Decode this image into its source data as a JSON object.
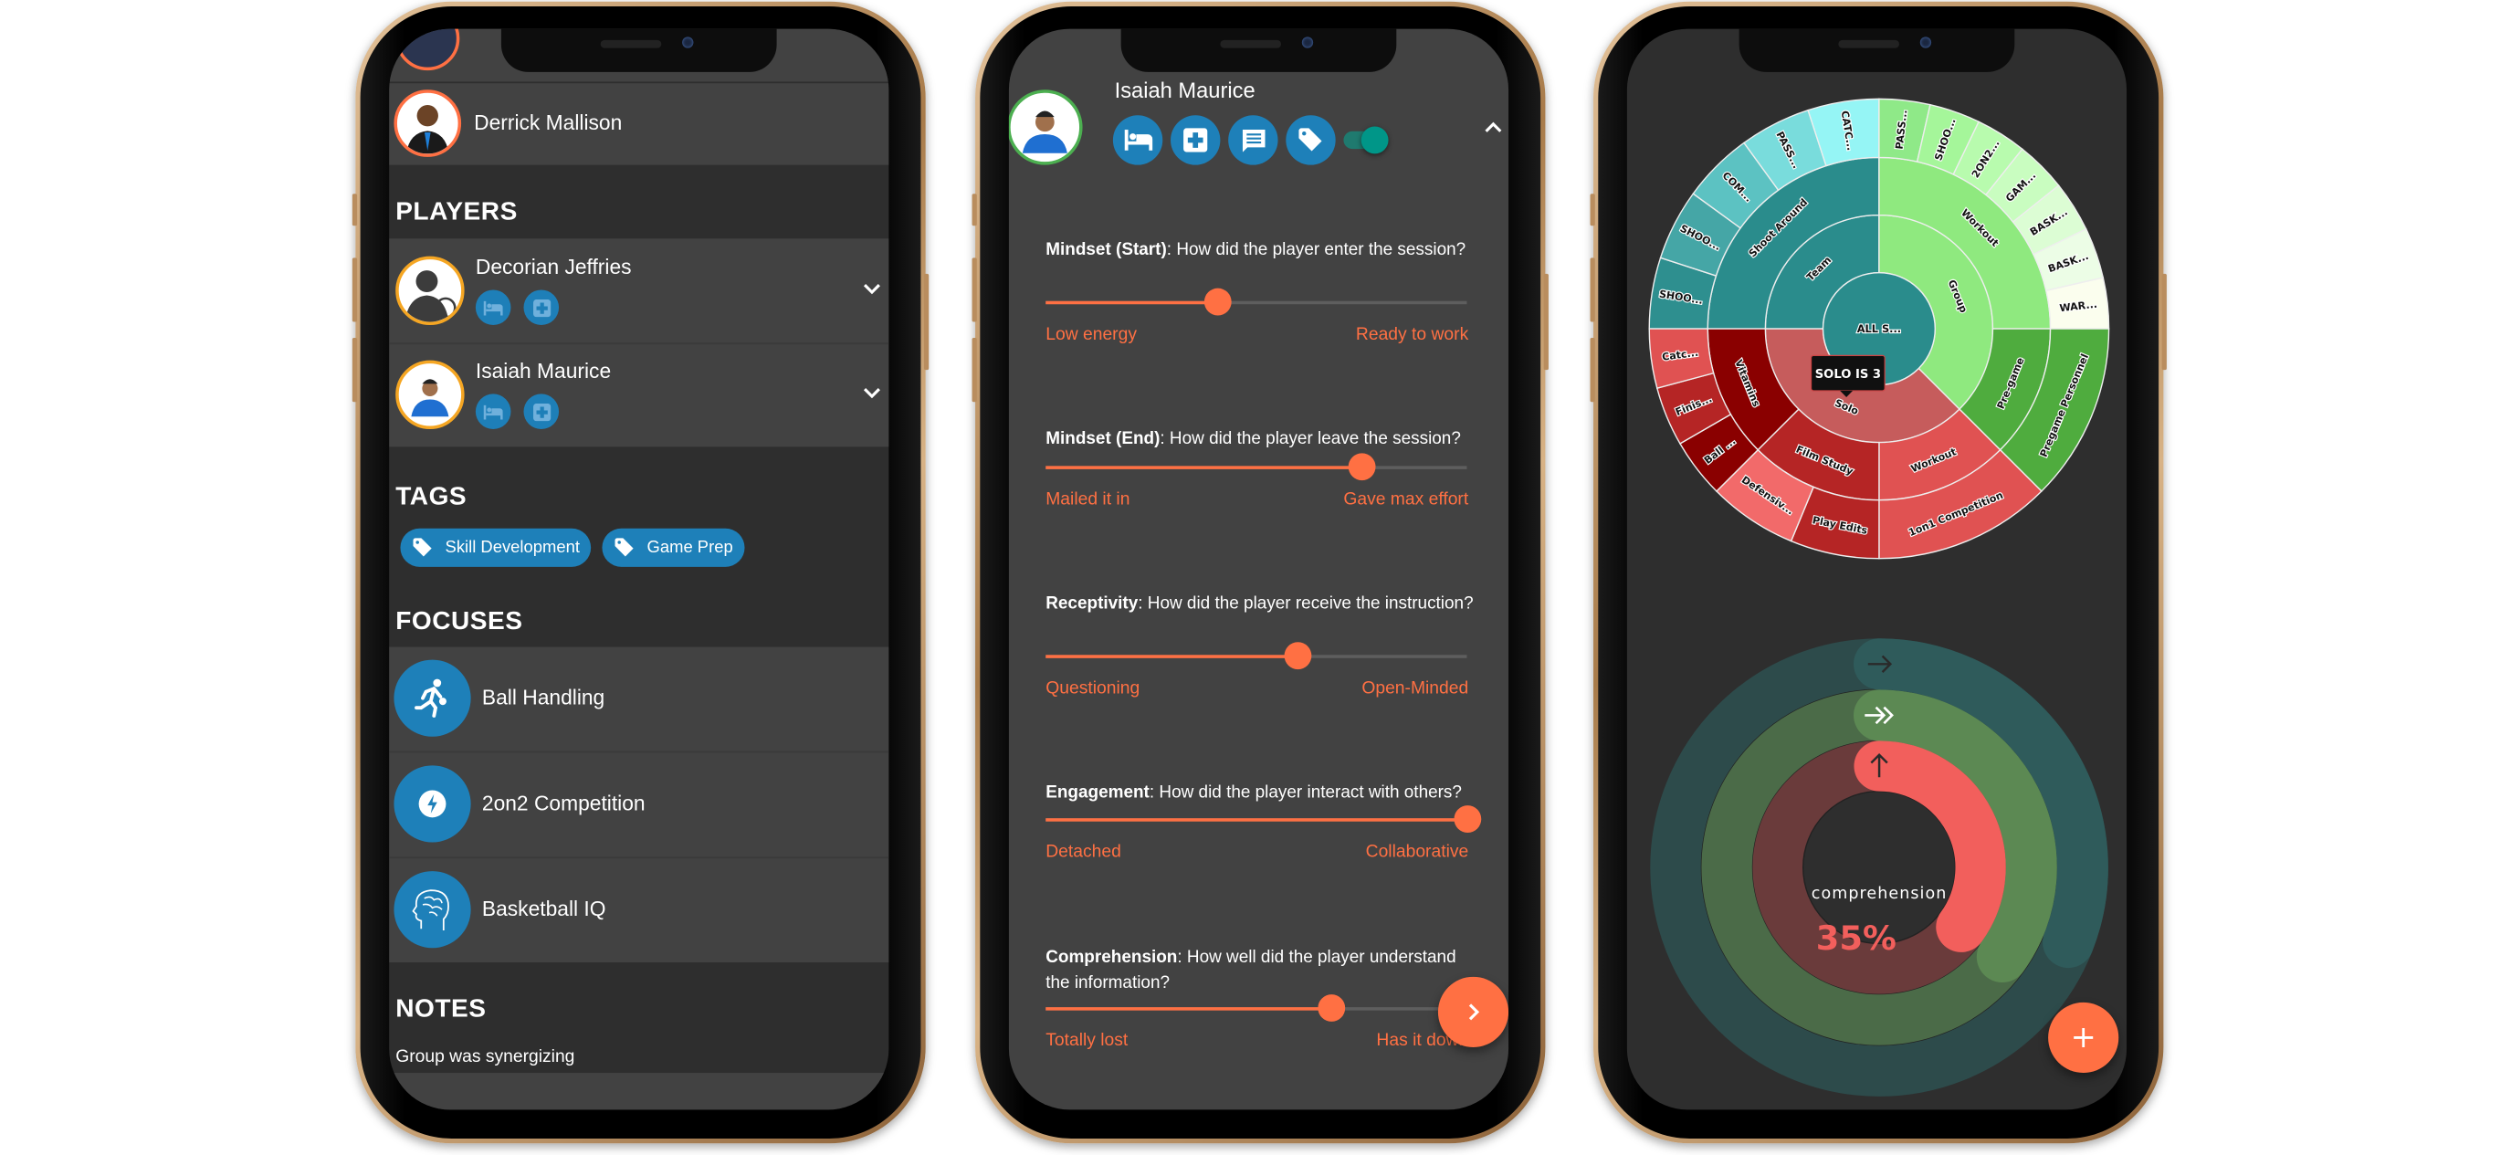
{
  "phone1": {
    "staff": [
      {
        "name": "Derrick Mallison"
      }
    ],
    "players_header": "PLAYERS",
    "players": [
      {
        "name": "Decorian Jeffries",
        "icons": [
          "bed-icon",
          "medical-icon"
        ]
      },
      {
        "name": "Isaiah Maurice",
        "icons": [
          "bed-icon",
          "medical-icon"
        ]
      }
    ],
    "tags_header": "TAGS",
    "tags": [
      {
        "label": "Skill Development"
      },
      {
        "label": "Game Prep"
      }
    ],
    "focuses_header": "FOCUSES",
    "focuses": [
      {
        "label": "Ball Handling",
        "icon": "dribbling-player-icon"
      },
      {
        "label": "2on2 Competition",
        "icon": "lightning-icon"
      },
      {
        "label": "Basketball IQ",
        "icon": "brain-icon"
      }
    ],
    "notes_header": "NOTES",
    "note": "Group was synergizing"
  },
  "phone2": {
    "player_name": "Isaiah Maurice",
    "toggle_on": true,
    "action_icons": [
      "bed-icon",
      "medical-icon",
      "message-icon",
      "tag-icon"
    ],
    "sliders": [
      {
        "title": "Mindset (Start)",
        "question": ": How did the player enter the session?",
        "min_label": "Low energy",
        "max_label": "Ready to work",
        "value": 0.41
      },
      {
        "title": "Mindset (End)",
        "question": ": How did the player leave the session?",
        "min_label": "Mailed it in",
        "max_label": "Gave max effort",
        "value": 0.75
      },
      {
        "title": "Receptivity",
        "question": ": How did the player receive the instruction?",
        "min_label": "Questioning",
        "max_label": "Open-Minded",
        "value": 0.6
      },
      {
        "title": "Engagement",
        "question": ": How did the player interact with others?",
        "min_label": "Detached",
        "max_label": "Collaborative",
        "value": 1.0
      },
      {
        "title": "Comprehension",
        "question": ": How well did the player understand the information?",
        "min_label": "Totally lost",
        "max_label": "Has it down",
        "value": 0.68
      }
    ],
    "fab_icon": "chevron-right-icon"
  },
  "phone3": {
    "fab_icon": "plus-icon"
  },
  "colors": {
    "accent": "#ff7043",
    "blue": "#1e80b9",
    "toggle": "#009688"
  },
  "chart_data": [
    {
      "type": "sunburst",
      "root": {
        "label": "ALL S...",
        "color": "#2a8c8c"
      },
      "tooltip": "SOLO IS 3",
      "children": [
        {
          "label": "Team",
          "value": 2,
          "color": "#2a8c8c",
          "children": [
            {
              "label": "Shoot Around",
              "value": 2,
              "color": "#2a8c8c",
              "children": [
                {
                  "label": "SHOO...",
                  "color": "#2e8f8f"
                },
                {
                  "label": "SHOO...",
                  "color": "#45a6a6"
                },
                {
                  "label": "COM...",
                  "color": "#5cc2c2"
                },
                {
                  "label": "PASS...",
                  "color": "#79dcdc"
                },
                {
                  "label": "CATC...",
                  "color": "#95f5f5"
                }
              ]
            }
          ]
        },
        {
          "label": "Group",
          "value": 3,
          "color": "#8fe97f",
          "children": [
            {
              "label": "Workout",
              "value": 2,
              "color": "#8fe97f",
              "children": [
                {
                  "label": "PASS...",
                  "color": "#8fe988"
                },
                {
                  "label": "SHOO...",
                  "color": "#a5f69a"
                },
                {
                  "label": "2ON2...",
                  "color": "#b8fbae"
                },
                {
                  "label": "GAM...",
                  "color": "#c9fdc0"
                },
                {
                  "label": "BASK...",
                  "color": "#dcfdd4"
                },
                {
                  "label": "BASK...",
                  "color": "#ecfde6"
                },
                {
                  "label": "WAR...",
                  "color": "#fbfeee"
                }
              ]
            },
            {
              "label": "Pre-game",
              "value": 1,
              "color": "#4fac3e",
              "children": [
                {
                  "label": "Pregame Personnel",
                  "color": "#4fac3e"
                }
              ]
            }
          ]
        },
        {
          "label": "Solo",
          "value": 3,
          "color": "#c65c5c",
          "children": [
            {
              "label": "Workout",
              "value": 1,
              "color": "#e05252",
              "children": [
                {
                  "label": "1on1 Competition",
                  "color": "#e05252"
                }
              ]
            },
            {
              "label": "Film Study",
              "value": 1,
              "color": "#b52525",
              "children": [
                {
                  "label": "Play Edits",
                  "color": "#b52525"
                },
                {
                  "label": "Defensiv...",
                  "color": "#f26a6a"
                }
              ]
            },
            {
              "label": "Vitamins",
              "value": 1,
              "color": "#8a0000",
              "children": [
                {
                  "label": "Ball ...",
                  "color": "#8a0000"
                },
                {
                  "label": "Finis...",
                  "color": "#b52525"
                },
                {
                  "label": "Catc...",
                  "color": "#e05252"
                }
              ]
            }
          ]
        }
      ]
    },
    {
      "type": "radial-progress",
      "center_label": "comprehension",
      "center_value": "35%",
      "rings": [
        {
          "icon": "arrow-right-icon",
          "value": 0.31,
          "track": "#2d4b4b",
          "color": "#2f5b5b",
          "icon_color": "#2a2a2a"
        },
        {
          "icon": "double-arrow-right-icon",
          "value": 0.35,
          "track": "#4b6b48",
          "color": "#5c8953",
          "icon_color": "#ffffff"
        },
        {
          "icon": "arrow-up-icon",
          "value": 0.35,
          "track": "#6a3b3b",
          "color": "#f25f5c",
          "icon_color": "#2a2a2a"
        }
      ]
    }
  ]
}
